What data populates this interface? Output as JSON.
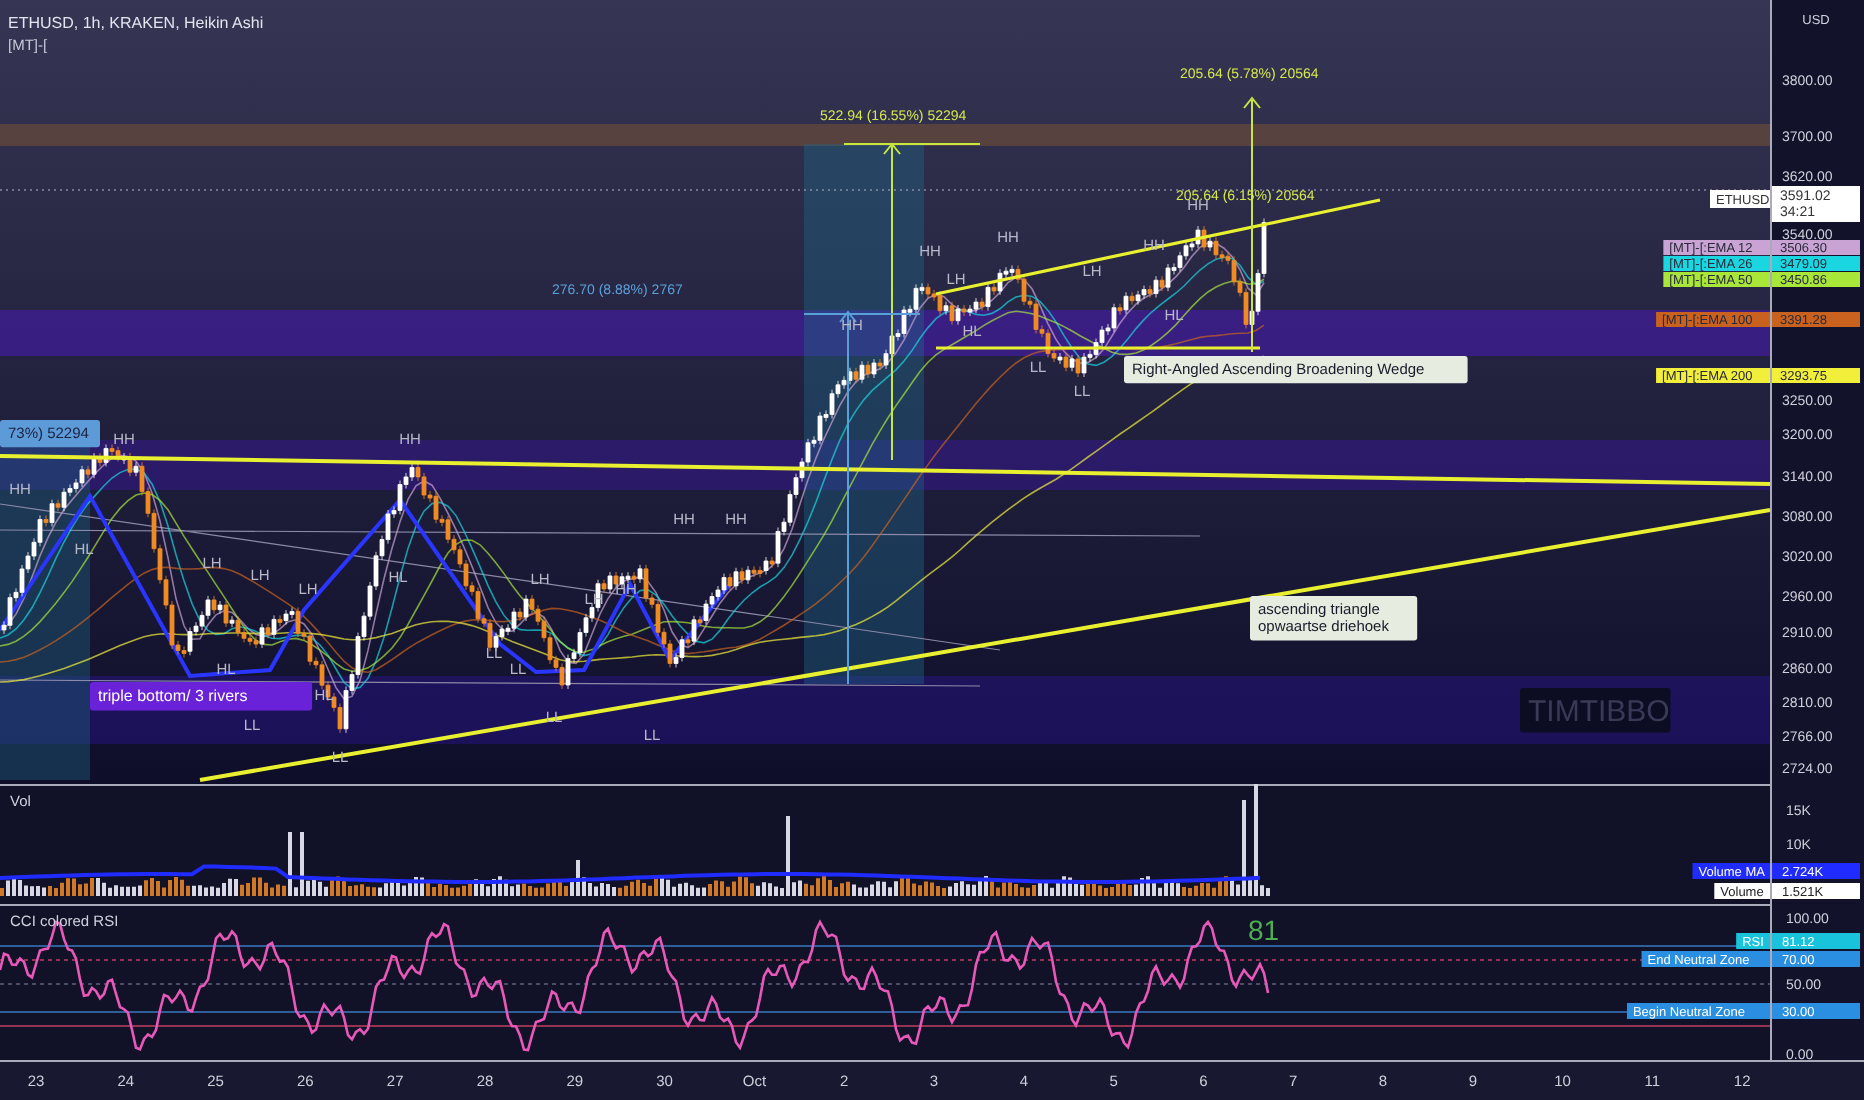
{
  "header": {
    "symbol_line": "ETHUSD, 1h, KRAKEN, Heikin Ashi",
    "indicator_line": "[MT]-["
  },
  "price_axis": {
    "currency": "USD",
    "ticks": [
      "3800.00",
      "3700.00",
      "3620.00",
      "3540.00",
      "3250.00",
      "3200.00",
      "3140.00",
      "3080.00",
      "3020.00",
      "2960.00",
      "2910.00",
      "2860.00",
      "2810.00",
      "2766.00",
      "2724.00"
    ]
  },
  "price_tag": {
    "symbol": "ETHUSD",
    "price": "3591.02",
    "countdown": "34:21"
  },
  "ema_tags": [
    {
      "label": "[MT]-[:EMA 12",
      "value": "3506.30",
      "color": "#c9a3d4"
    },
    {
      "label": "[MT]-[:EMA 26",
      "value": "3479.09",
      "color": "#19d6e0"
    },
    {
      "label": "[MT]-[:EMA 50",
      "value": "3450.86",
      "color": "#a8e63a"
    },
    {
      "label": "[MT]-[:EMA 100",
      "value": "3391.28",
      "color": "#c8621e"
    },
    {
      "label": "[MT]-[:EMA 200",
      "value": "3293.75",
      "color": "#f2ef3a"
    }
  ],
  "measurements": [
    {
      "text": "522.94 (16.55%) 52294",
      "color": "#d6e84a"
    },
    {
      "text": "205.64 (5.78%) 20564",
      "color": "#d6e84a"
    },
    {
      "text": "205.64 (6.15%) 20564",
      "color": "#d6e84a"
    },
    {
      "text": "276.70 (8.88%) 2767",
      "color": "#5aa0d8"
    }
  ],
  "swing_labels": [
    "HH",
    "HH",
    "HL",
    "LH",
    "LH",
    "LH",
    "HL",
    "HL",
    "LL",
    "LL",
    "HH",
    "HL",
    "LH",
    "LH",
    "HH",
    "LL",
    "LL",
    "LL",
    "LL",
    "HH",
    "HH",
    "HH",
    "HH",
    "LH",
    "HL",
    "HH",
    "LL",
    "LH",
    "HH",
    "HL",
    "HH",
    "LL"
  ],
  "notes": [
    {
      "kind": "badge",
      "lines": [
        "73%) 52294"
      ]
    },
    {
      "kind": "highlight",
      "lines": [
        "triple bottom/ 3 rivers"
      ]
    },
    {
      "kind": "callout",
      "lines": [
        "Right-Angled Ascending Broadening Wedge"
      ]
    },
    {
      "kind": "callout",
      "lines": [
        "ascending triangle",
        "opwaartse driehoek"
      ]
    },
    {
      "kind": "signature",
      "lines": [
        "TIMTIBBO"
      ]
    }
  ],
  "volume_pane": {
    "title": "Vol",
    "ticks": [
      "15K",
      "10K"
    ],
    "tags": [
      {
        "label": "Volume MA",
        "value": "2.724K",
        "color": "#1f2bff"
      },
      {
        "label": "Volume",
        "value": "1.521K",
        "color": "#ffffff"
      }
    ]
  },
  "rsi_pane": {
    "title": "CCI colored RSI",
    "reading": "81",
    "ticks": [
      "100.00",
      "50.00",
      "0.00"
    ],
    "tags": [
      {
        "label": "RSI",
        "value": "81.12",
        "color": "#19c3dc"
      },
      {
        "label": "End Neutral Zone",
        "value": "70.00",
        "color": "#2a8fe0"
      },
      {
        "label": "Begin Neutral Zone",
        "value": "30.00",
        "color": "#2a8fe0"
      }
    ]
  },
  "time_axis": [
    "23",
    "24",
    "25",
    "26",
    "27",
    "28",
    "29",
    "30",
    "Oct",
    "2",
    "3",
    "4",
    "5",
    "6",
    "7",
    "8",
    "9",
    "10",
    "11",
    "12"
  ]
}
